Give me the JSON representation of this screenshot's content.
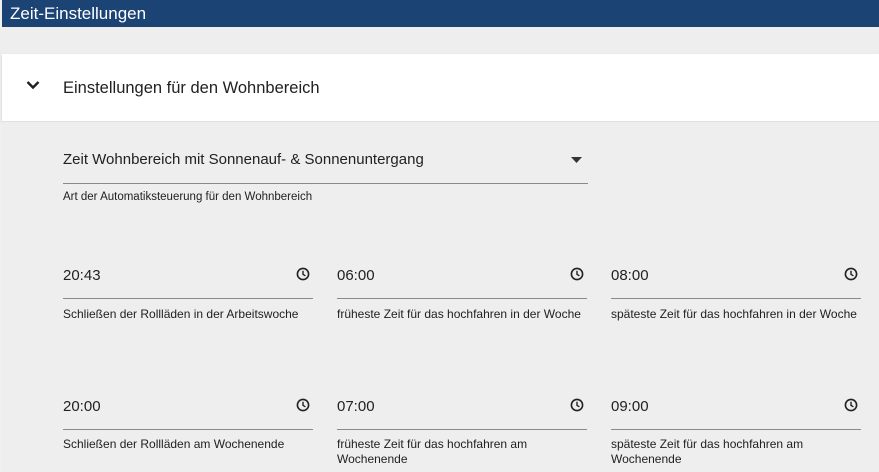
{
  "header": {
    "title": "Zeit-Einstellungen"
  },
  "section": {
    "title": "Einstellungen für den Wohnbereich"
  },
  "mode_select": {
    "value": "Zeit Wohnbereich mit Sonnenauf- & Sonnenuntergang",
    "helper": "Art der Automatiksteuerung für den Wohnbereich"
  },
  "times": [
    {
      "value": "20:43",
      "label": "Schließen der Rollläden in der Arbeitswoche"
    },
    {
      "value": "06:00",
      "label": "früheste Zeit für das hochfahren in der Woche"
    },
    {
      "value": "08:00",
      "label": "späteste Zeit für das hochfahren in der Woche"
    },
    {
      "value": "20:00",
      "label": "Schließen der Rollläden am Wochenende"
    },
    {
      "value": "07:00",
      "label": "früheste Zeit für das hochfahren am Wochenende"
    },
    {
      "value": "09:00",
      "label": "späteste Zeit für das hochfahren am Wochenende"
    }
  ],
  "icons": {
    "collapse": "chevron-down-icon",
    "dropdown": "caret-down-icon",
    "time": "clock-icon"
  },
  "colors": {
    "header_bg": "#1b4374",
    "panel_bg": "#eeeeee"
  }
}
